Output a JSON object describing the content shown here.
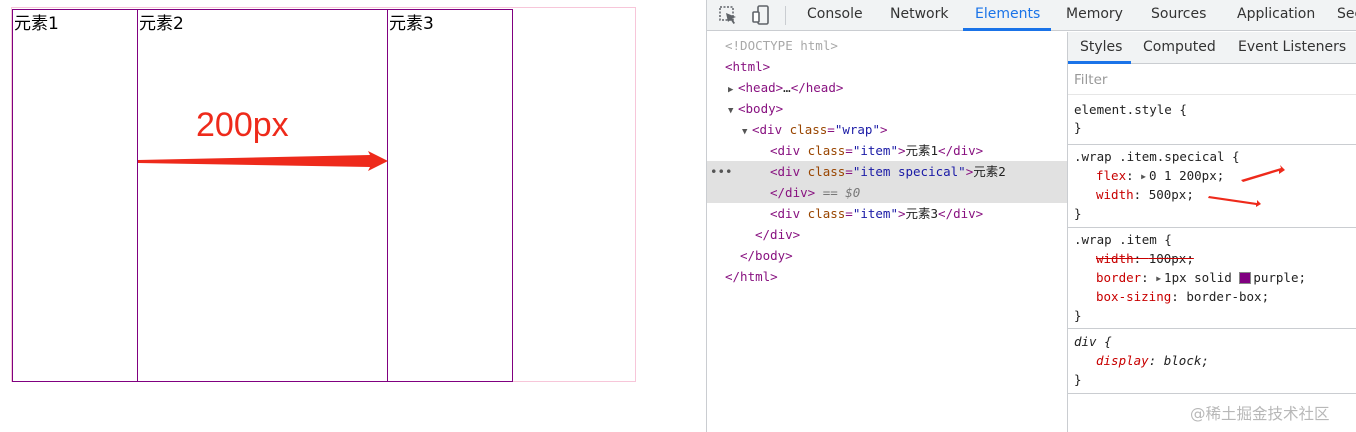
{
  "page": {
    "items": [
      {
        "label": "元素1"
      },
      {
        "label": "元素2"
      },
      {
        "label": "元素3"
      }
    ],
    "annotation": {
      "label": "200px",
      "color": "#ee2a1b"
    }
  },
  "devtools": {
    "toolbar": {
      "inspect_icon": "element-picker-icon",
      "device_icon": "device-toolbar-icon"
    },
    "tabs": [
      "Console",
      "Network",
      "Elements",
      "Memory",
      "Sources",
      "Application",
      "Sec"
    ],
    "active_tab": "Elements",
    "dom": {
      "doctype": "<!DOCTYPE html>",
      "html_open": "html",
      "head_open": "head",
      "head_ellipsis": "…",
      "head_close": "/head",
      "body_open": "body",
      "div_tag": "div",
      "class_attr": "class",
      "wrap_class": "\"wrap\"",
      "item_class": "\"item\"",
      "special_class": "\"item specical\"",
      "item1_text": "元素1",
      "item2_text": "元素2",
      "item3_text": "元素3",
      "close_div": "/div",
      "selected_marker": "== $0",
      "body_close": "/body",
      "html_close": "/html",
      "dots": "•••"
    },
    "styles": {
      "sub_tabs": [
        "Styles",
        "Computed",
        "Event Listeners"
      ],
      "active_sub_tab": "Styles",
      "filter_placeholder": "Filter",
      "rules": {
        "element_style": {
          "selector": "element.style {",
          "close": "}"
        },
        "special": {
          "selector": ".wrap .item.specical {",
          "flex_name": "flex",
          "flex_value": "0 1 200px;",
          "width_name": "width",
          "width_value": "500px;",
          "close": "}"
        },
        "item": {
          "selector": ".wrap .item {",
          "width_name": "width",
          "width_value": "100px;",
          "border_name": "border",
          "border_value": "1px solid ",
          "border_color": "purple",
          "border_color_after": ";",
          "box_sizing_name": "box-sizing",
          "box_sizing_value": "border-box;",
          "close": "}"
        },
        "div_ua": {
          "selector": "div {",
          "display_name": "display",
          "display_value": "block;",
          "close": "}"
        }
      }
    },
    "watermark": "@稀土掘金技术社区"
  }
}
